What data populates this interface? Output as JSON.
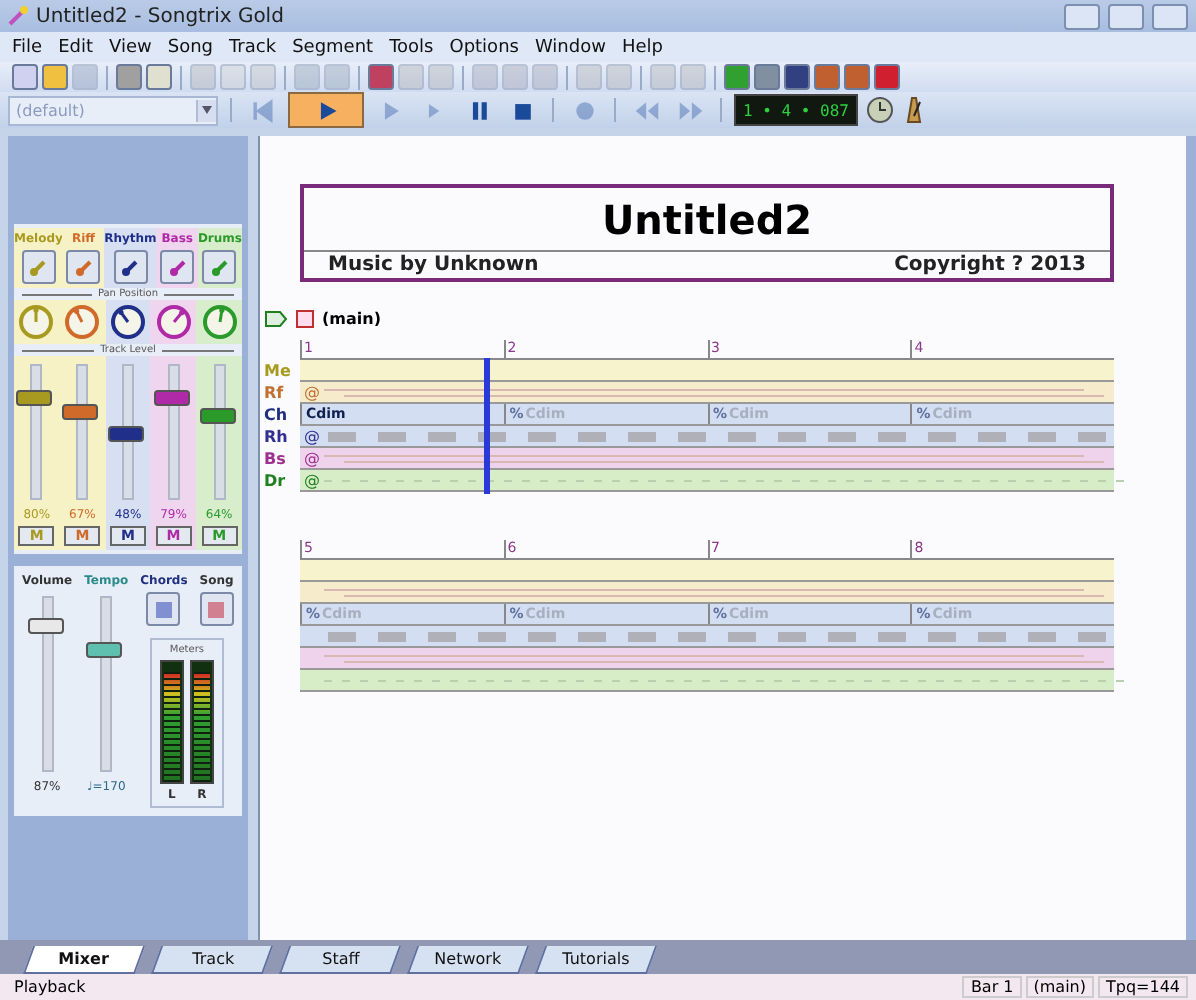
{
  "window": {
    "title": "Untitled2 - Songtrix Gold"
  },
  "menu": [
    "File",
    "Edit",
    "View",
    "Song",
    "Track",
    "Segment",
    "Tools",
    "Options",
    "Window",
    "Help"
  ],
  "toolbar": [
    {
      "kind": "new",
      "disabled": false
    },
    {
      "kind": "open",
      "disabled": false
    },
    {
      "kind": "save",
      "disabled": true
    },
    {
      "kind": "sep"
    },
    {
      "kind": "print",
      "disabled": false
    },
    {
      "kind": "preview",
      "disabled": false
    },
    {
      "kind": "sep"
    },
    {
      "kind": "cut",
      "disabled": true
    },
    {
      "kind": "copy",
      "disabled": true
    },
    {
      "kind": "paste",
      "disabled": true
    },
    {
      "kind": "sep"
    },
    {
      "kind": "undo",
      "disabled": true
    },
    {
      "kind": "redo",
      "disabled": true
    },
    {
      "kind": "sep"
    },
    {
      "kind": "song",
      "disabled": false
    },
    {
      "kind": "up",
      "disabled": true
    },
    {
      "kind": "down",
      "disabled": true
    },
    {
      "kind": "sep"
    },
    {
      "kind": "filter",
      "disabled": true
    },
    {
      "kind": "quantize",
      "disabled": true
    },
    {
      "kind": "lyric",
      "disabled": true
    },
    {
      "kind": "sep"
    },
    {
      "kind": "grid",
      "disabled": true
    },
    {
      "kind": "list",
      "disabled": true
    },
    {
      "kind": "sep"
    },
    {
      "kind": "slash",
      "disabled": true
    },
    {
      "kind": "at",
      "disabled": true
    },
    {
      "kind": "sep"
    },
    {
      "kind": "addtrack",
      "disabled": false
    },
    {
      "kind": "sheet",
      "disabled": false
    },
    {
      "kind": "note",
      "disabled": false
    },
    {
      "kind": "notes",
      "disabled": false
    },
    {
      "kind": "notes",
      "disabled": false
    },
    {
      "kind": "colors",
      "disabled": false
    }
  ],
  "style_select": {
    "value": "(default)"
  },
  "transport": [
    {
      "kind": "start",
      "disabled": true,
      "selected": false
    },
    {
      "kind": "play",
      "disabled": false,
      "selected": true
    },
    {
      "kind": "playfrom",
      "disabled": true,
      "selected": false
    },
    {
      "kind": "step",
      "disabled": true,
      "selected": false
    },
    {
      "kind": "pause",
      "disabled": false,
      "selected": false
    },
    {
      "kind": "stop",
      "disabled": false,
      "selected": false
    },
    {
      "kind": "sep"
    },
    {
      "kind": "record",
      "disabled": true,
      "selected": false
    },
    {
      "kind": "sep"
    },
    {
      "kind": "rewind",
      "disabled": true,
      "selected": false
    },
    {
      "kind": "forward",
      "disabled": true,
      "selected": false
    }
  ],
  "counter": "1 • 4 • 087",
  "mixer": {
    "pan_label": "Pan Position",
    "level_label": "Track Level",
    "tracks": [
      {
        "name": "Melody",
        "color": "#a89a20",
        "pan": {
          "level": 0.5
        },
        "level": 0.8,
        "reading": "80%",
        "mute": "M"
      },
      {
        "name": "Riff",
        "color": "#d06a2a",
        "pan": {
          "level": 0.35
        },
        "level": 0.67,
        "reading": "67%",
        "mute": "M"
      },
      {
        "name": "Rhythm",
        "color": "#20308a",
        "pan": {
          "level": 0.3
        },
        "level": 0.48,
        "reading": "48%",
        "mute": "M"
      },
      {
        "name": "Bass",
        "color": "#b02aa8",
        "pan": {
          "level": 0.72
        },
        "level": 0.79,
        "reading": "79%",
        "mute": "M"
      },
      {
        "name": "Drums",
        "color": "#2a9a2a",
        "pan": {
          "level": 0.55
        },
        "level": 0.64,
        "reading": "64%",
        "mute": "M"
      }
    ]
  },
  "master": {
    "volume": {
      "label": "Volume",
      "level": 0.87,
      "reading": "87%"
    },
    "tempo": {
      "label": "Tempo",
      "level": 0.72,
      "reading": "♩=170"
    },
    "chords_label": "Chords",
    "song_label": "Song",
    "meters_label": "Meters",
    "meters": [
      {
        "label": "L",
        "level": 0.92
      },
      {
        "label": "R",
        "level": 0.92
      }
    ]
  },
  "score": {
    "title": "Untitled2",
    "composer": "Music by Unknown",
    "copyright": "Copyright ? 2013",
    "marker": "(main)",
    "systems": [
      {
        "bars": [
          "1",
          "2",
          "3",
          "4"
        ],
        "rows": [
          {
            "label": "Me",
            "kind": "plain"
          },
          {
            "label": "Rf",
            "kind": "lines",
            "start_mark": "@"
          },
          {
            "label": "Ch",
            "kind": "chords"
          },
          {
            "label": "Rh",
            "kind": "blocks",
            "start_mark": "@"
          },
          {
            "label": "Bs",
            "kind": "lines",
            "start_mark": "@"
          },
          {
            "label": "Dr",
            "kind": "dashes",
            "start_mark": "@"
          }
        ],
        "chords": [
          {
            "kind": "chord",
            "text": "Cdim"
          },
          {
            "kind": "repeat",
            "symbol": "%",
            "text": "Cdim"
          },
          {
            "kind": "repeat",
            "symbol": "%",
            "text": "Cdim"
          },
          {
            "kind": "repeat",
            "symbol": "%",
            "text": "Cdim"
          }
        ]
      },
      {
        "bars": [
          "5",
          "6",
          "7",
          "8"
        ],
        "rows": [
          {
            "kind": "plain"
          },
          {
            "kind": "lines"
          },
          {
            "kind": "chords"
          },
          {
            "kind": "blocks"
          },
          {
            "kind": "lines"
          },
          {
            "kind": "dashes"
          }
        ],
        "chords": [
          {
            "kind": "repeat",
            "symbol": "%",
            "text": "Cdim"
          },
          {
            "kind": "repeat",
            "symbol": "%",
            "text": "Cdim"
          },
          {
            "kind": "repeat",
            "symbol": "%",
            "text": "Cdim"
          },
          {
            "kind": "repeat",
            "symbol": "%",
            "text": "Cdim"
          }
        ]
      }
    ]
  },
  "tabs": [
    {
      "label": "Mixer",
      "selected": true
    },
    {
      "label": "Track",
      "selected": false
    },
    {
      "label": "Staff",
      "selected": false
    },
    {
      "label": "Network",
      "selected": false
    },
    {
      "label": "Tutorials",
      "selected": false
    }
  ],
  "status_bar": {
    "left": "Playback",
    "cells": [
      "Bar 1",
      "(main)",
      "Tpq=144"
    ]
  }
}
